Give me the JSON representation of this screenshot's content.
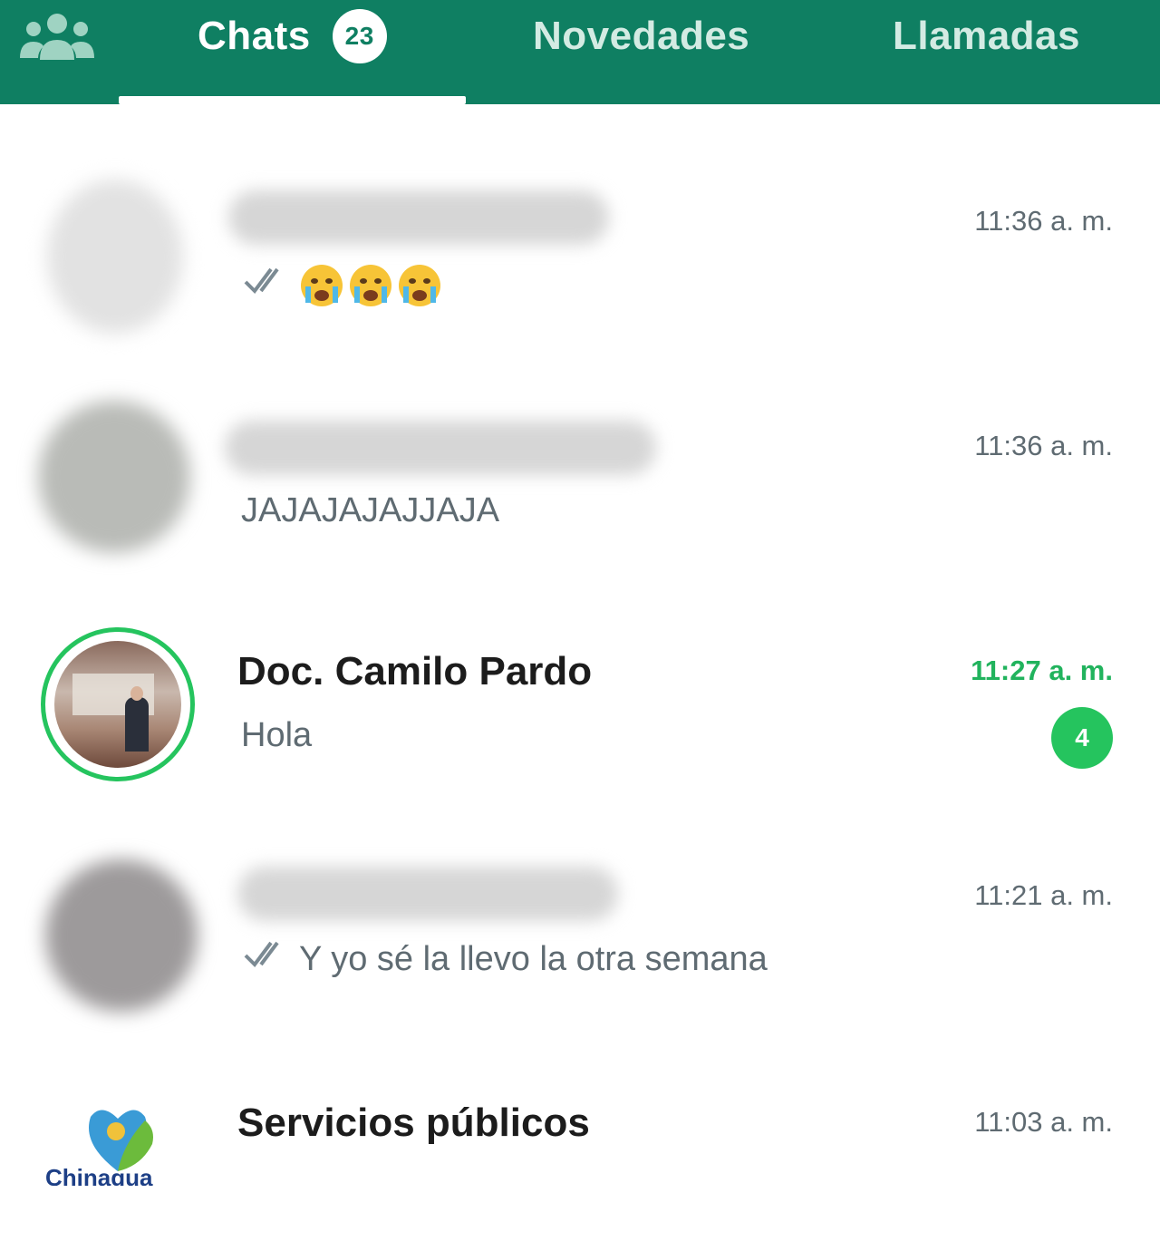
{
  "tabs": {
    "community_icon": "community-icon",
    "chats_label": "Chats",
    "chats_badge": "23",
    "novedades_label": "Novedades",
    "llamadas_label": "Llamadas",
    "active_tab": "Chats"
  },
  "chats": [
    {
      "name": "",
      "preview_emoji": [
        "crying-face-emoji",
        "crying-face-emoji",
        "crying-face-emoji"
      ],
      "time": "11:36 a. m.",
      "read_ticks": true
    },
    {
      "name": "",
      "preview": "JAJAJAJAJJAJA",
      "time": "11:36 a. m."
    },
    {
      "name": "Doc. Camilo Pardo",
      "preview": "Hola",
      "time": "11:27 a. m.",
      "unread_count": "4"
    },
    {
      "name": "",
      "preview": "Y yo sé la llevo la otra semana",
      "time": "11:21 a. m.",
      "read_ticks": true
    },
    {
      "name": "Servicios públicos",
      "preview": "",
      "time": "11:03 a. m."
    }
  ],
  "colors": {
    "header": "#0f7f62",
    "accent_green": "#21b35d",
    "badge_green": "#25c45e"
  }
}
